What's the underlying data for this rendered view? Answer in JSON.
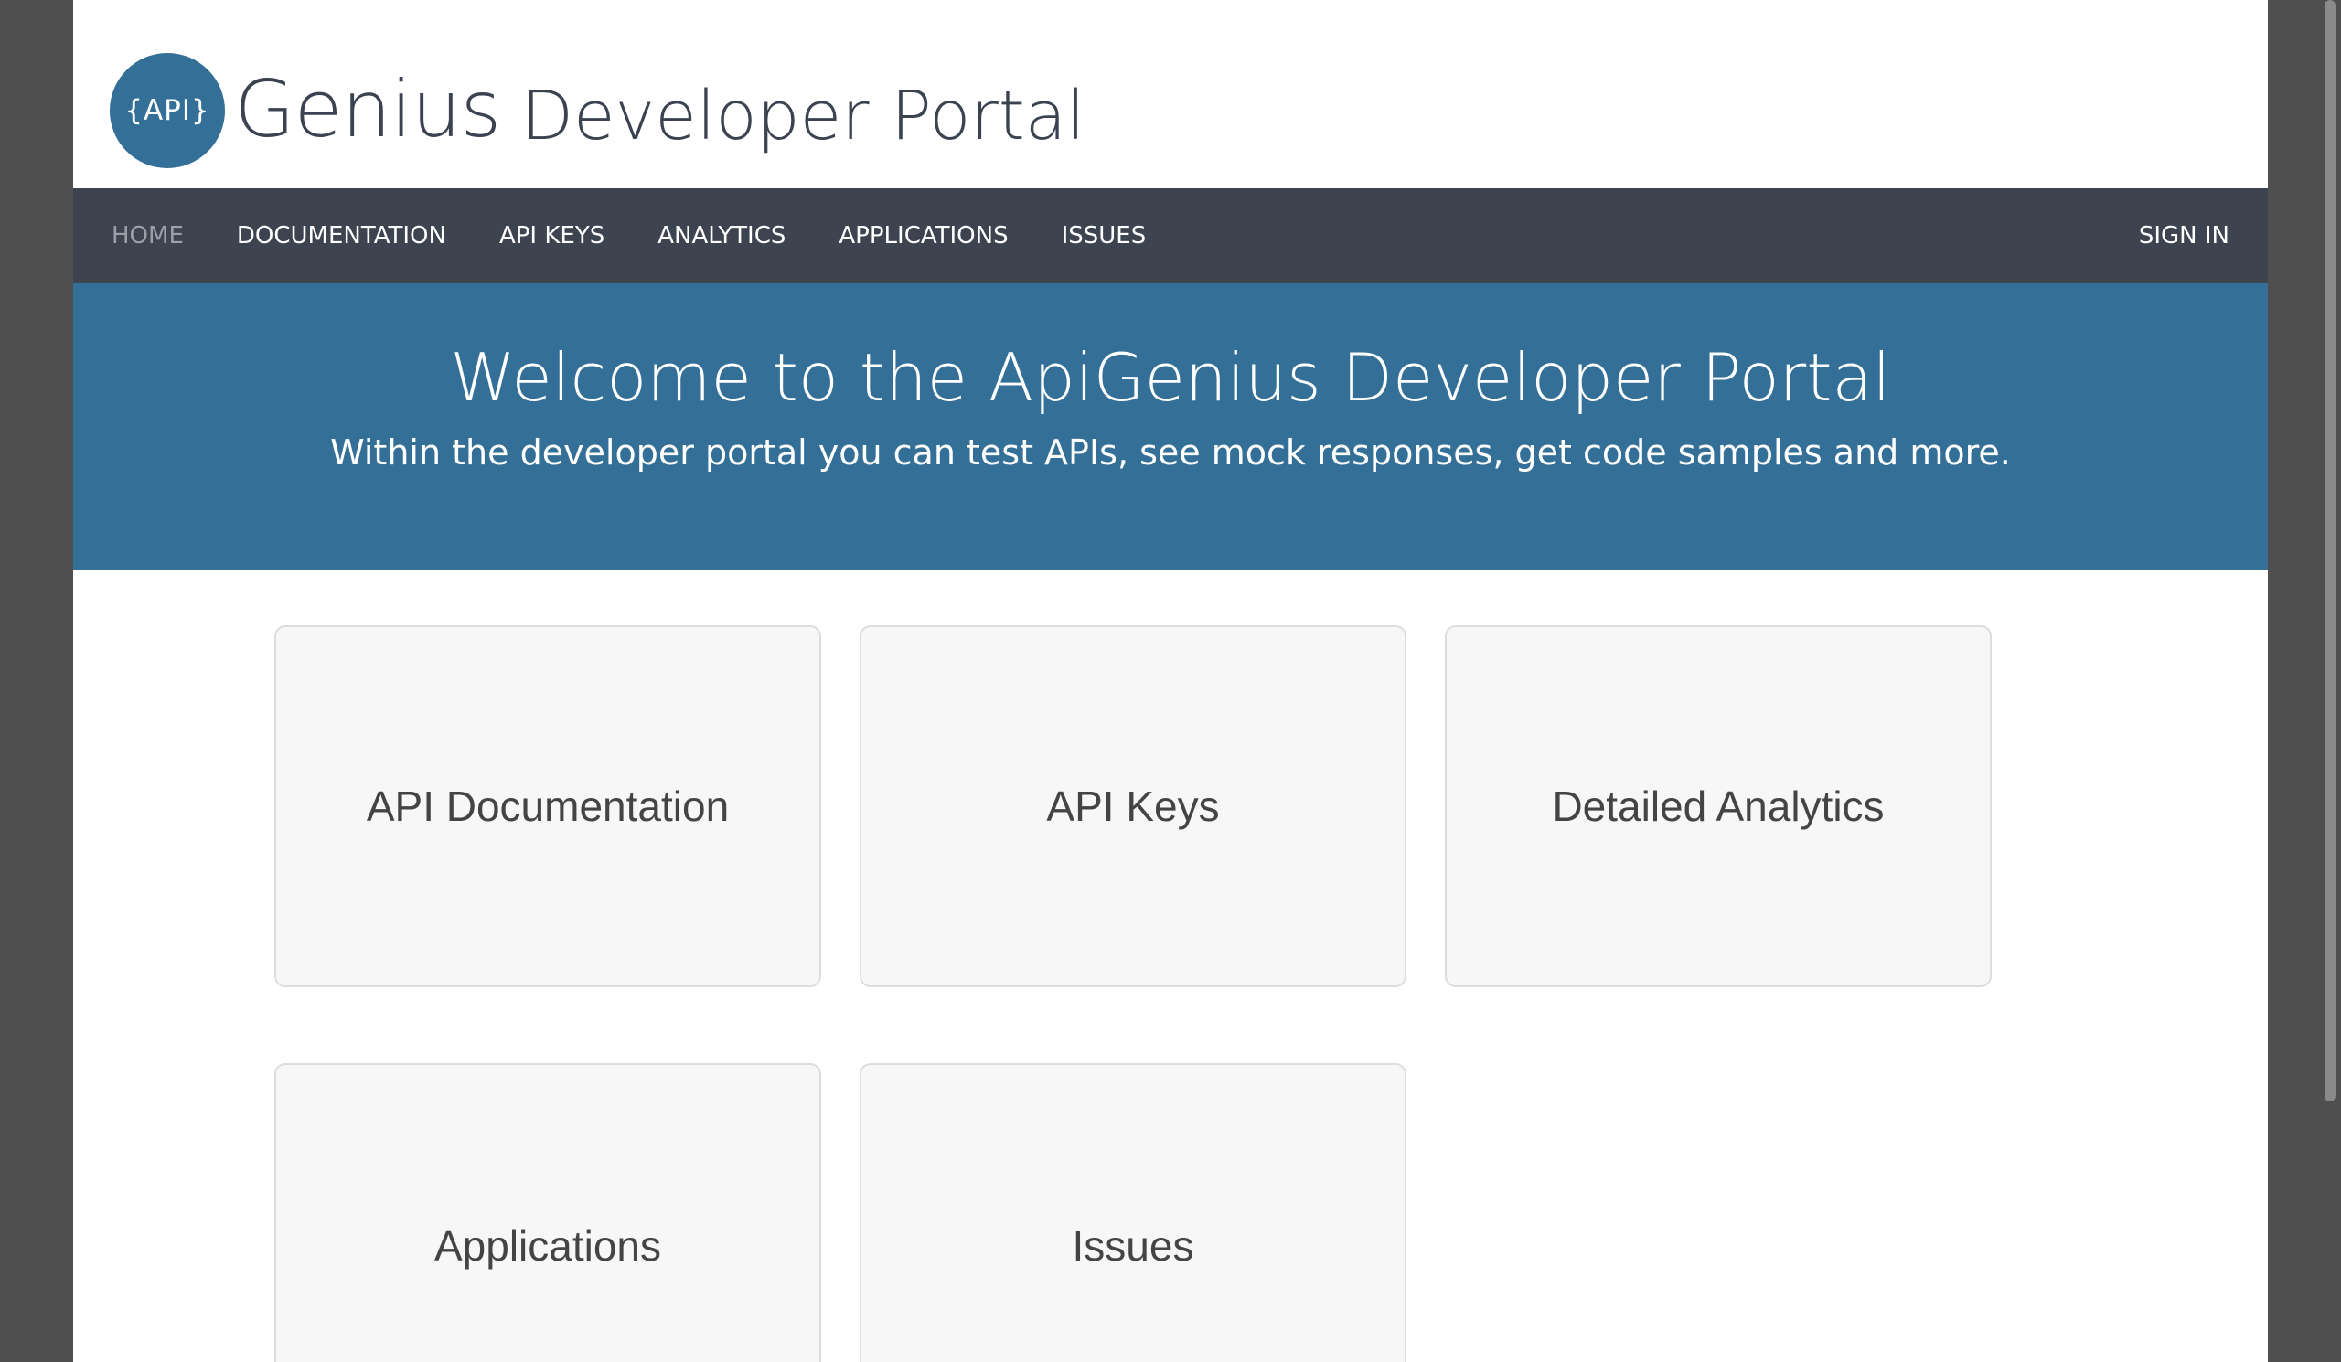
{
  "brand": {
    "logo_text": "{API}",
    "logo_word": "Genius",
    "portal_title": "Developer Portal",
    "accent_color": "#336f96"
  },
  "nav": {
    "items": [
      {
        "label": "HOME",
        "active": true
      },
      {
        "label": "DOCUMENTATION",
        "active": false
      },
      {
        "label": "API KEYS",
        "active": false
      },
      {
        "label": "ANALYTICS",
        "active": false
      },
      {
        "label": "APPLICATIONS",
        "active": false
      },
      {
        "label": "ISSUES",
        "active": false
      }
    ],
    "signin_label": "SIGN IN",
    "bg_color": "#3d434f"
  },
  "hero": {
    "title": "Welcome to the ApiGenius Developer Portal",
    "subtitle": "Within the developer portal you can test APIs, see mock responses, get code samples and more."
  },
  "tiles": [
    {
      "label": "API Documentation"
    },
    {
      "label": "API Keys"
    },
    {
      "label": "Detailed Analytics"
    },
    {
      "label": "Applications"
    },
    {
      "label": "Issues"
    }
  ]
}
